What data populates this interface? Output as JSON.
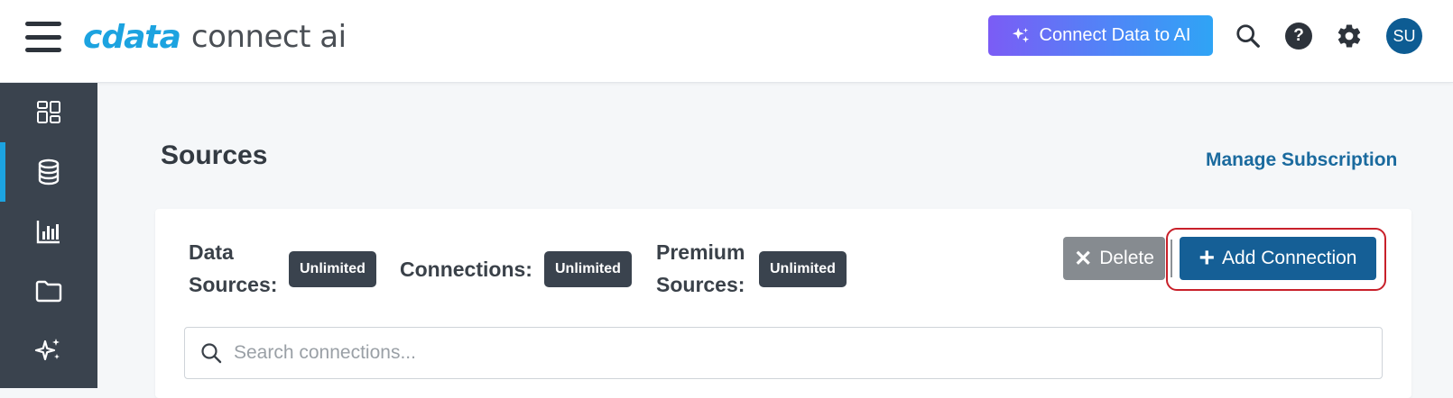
{
  "header": {
    "brand_logo": "cdata",
    "product_name": "connect ai",
    "ai_button_label": "Connect Data to AI",
    "avatar_initials": "SU",
    "icons": [
      "menu-icon",
      "sparkle-icon",
      "search-icon",
      "help-icon",
      "gear-icon"
    ]
  },
  "sidebar": {
    "items": [
      {
        "name": "dashboard",
        "icon": "dashboard-grid-icon",
        "active": false
      },
      {
        "name": "sources",
        "icon": "database-icon",
        "active": true
      },
      {
        "name": "analytics",
        "icon": "bar-chart-icon",
        "active": false
      },
      {
        "name": "folders",
        "icon": "folder-icon",
        "active": false
      },
      {
        "name": "ai",
        "icon": "sparkle-icon",
        "active": false
      }
    ]
  },
  "main": {
    "title": "Sources",
    "manage_link": "Manage Subscription",
    "stats": [
      {
        "label_line1": "Data",
        "label_line2": "Sources:",
        "value": "Unlimited"
      },
      {
        "label_line1": "Connections:",
        "label_line2": "",
        "value": "Unlimited"
      },
      {
        "label_line1": "Premium",
        "label_line2": "Sources:",
        "value": "Unlimited"
      }
    ],
    "delete_label": "Delete",
    "add_label": "Add Connection",
    "search_placeholder": "Search connections..."
  },
  "colors": {
    "brand": "#1ca3e0",
    "sidebar_bg": "#3a434e",
    "primary_button": "#155f96",
    "disabled_button": "#868b90",
    "highlight": "#c8202a"
  }
}
